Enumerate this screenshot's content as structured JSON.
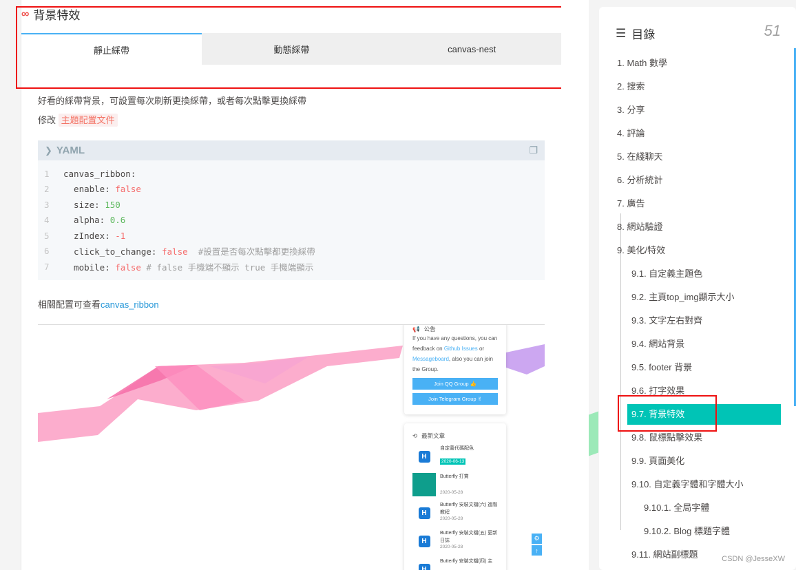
{
  "section": {
    "title": "背景特效"
  },
  "tabs": [
    {
      "label": "靜止綵帶",
      "active": true
    },
    {
      "label": "動態綵帶",
      "active": false
    },
    {
      "label": "canvas-nest",
      "active": false
    }
  ],
  "intro": {
    "line1": "好看的綵帶背景，可設置每次刷新更換綵帶，或者每次點擊更換綵帶",
    "line2_prefix": "修改",
    "line2_code": "主題配置文件"
  },
  "codeblock": {
    "lang": "YAML",
    "line_numbers": [
      "1",
      "2",
      "3",
      "4",
      "5",
      "6",
      "7"
    ],
    "lines": [
      {
        "key": "canvas_ribbon:",
        "value": "",
        "comment": ""
      },
      {
        "key": "  enable: ",
        "value": "false",
        "comment": ""
      },
      {
        "key": "  size: ",
        "value": "150",
        "comment": ""
      },
      {
        "key": "  alpha: ",
        "value": "0.6",
        "comment": ""
      },
      {
        "key": "  zIndex: ",
        "value": "-1",
        "comment": ""
      },
      {
        "key": "  click_to_change: ",
        "value": "false",
        "comment": "  #設置是否每次點擊都更換綵帶"
      },
      {
        "key": "  mobile: ",
        "value": "false",
        "comment": " # false 手機端不顯示 true 手機端顯示"
      }
    ]
  },
  "related": {
    "prefix": "相關配置可查看",
    "link": "canvas_ribbon"
  },
  "embed": {
    "announce_title": "公告",
    "announce_text1": "If you have any questions, you can feedback on ",
    "announce_link1": "Github Issues",
    "announce_text2": " or ",
    "announce_link2": "Messageboard",
    "announce_text3": ", also you can join the Group.",
    "btn_qq": "Join QQ Group 👍",
    "btn_tg": "Join Telegram Group ✌",
    "recent_title": "最新文章",
    "posts": [
      {
        "title": "自定義代碼配色",
        "date": "2020-06-13",
        "thumb": "H"
      },
      {
        "title": "Butterfly 打賞",
        "date": "2020-05-28",
        "thumb": ""
      },
      {
        "title": "Butterfly 安裝文檔(六) 進階教程",
        "date": "2020-05-28",
        "thumb": "H"
      },
      {
        "title": "Butterfly 安裝文檔(五) 更新日誌",
        "date": "2020-05-28",
        "thumb": "H"
      },
      {
        "title": "Butterfly 安裝文檔(四) 主",
        "date": "",
        "thumb": "H"
      }
    ]
  },
  "toc": {
    "title": "目錄",
    "count": "51",
    "items": [
      {
        "label": "1. Math 數學",
        "level": 1
      },
      {
        "label": "2. 搜索",
        "level": 1
      },
      {
        "label": "3. 分享",
        "level": 1
      },
      {
        "label": "4. 評論",
        "level": 1
      },
      {
        "label": "5. 在綫聊天",
        "level": 1
      },
      {
        "label": "6. 分析統計",
        "level": 1
      },
      {
        "label": "7. 廣告",
        "level": 1
      },
      {
        "label": "8. 網站驗證",
        "level": 1
      },
      {
        "label": "9. 美化/特效",
        "level": 1
      },
      {
        "label": "9.1. 自定義主題色",
        "level": 2
      },
      {
        "label": "9.2. 主頁top_img顯示大小",
        "level": 2
      },
      {
        "label": "9.3. 文字左右對齊",
        "level": 2
      },
      {
        "label": "9.4. 網站背景",
        "level": 2
      },
      {
        "label": "9.5. footer 背景",
        "level": 2
      },
      {
        "label": "9.6. 打字效果",
        "level": 2
      },
      {
        "label": "9.7. 背景特效",
        "level": 2,
        "active": true
      },
      {
        "label": "9.8. 鼠標點擊效果",
        "level": 2
      },
      {
        "label": "9.9. 頁面美化",
        "level": 2
      },
      {
        "label": "9.10. 自定義字體和字體大小",
        "level": 2
      },
      {
        "label": "9.10.1. 全局字體",
        "level": 3
      },
      {
        "label": "9.10.2. Blog 標題字體",
        "level": 3
      },
      {
        "label": "9.11. 網站副標題",
        "level": 2
      }
    ]
  },
  "watermark": "CSDN @JesseXW",
  "colors": {
    "accent": "#00c4b6",
    "link": "#49b1f5",
    "highlight_box": "#e11111"
  }
}
